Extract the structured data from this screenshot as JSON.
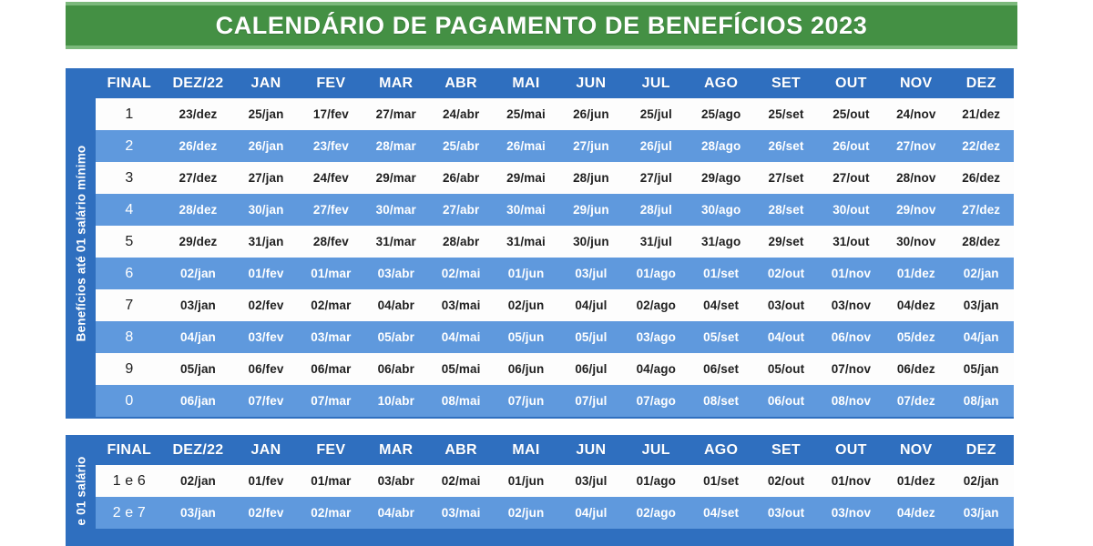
{
  "banner": {
    "title": "CALENDÁRIO DE PAGAMENTO DE BENEFÍCIOS 2023",
    "bg_color": "#449044",
    "edge_color": "#7cb97c",
    "text_color": "#ffffff"
  },
  "theme": {
    "header_blue": "#2f6fbf",
    "row_blue": "#5f99dd",
    "row_white": "#fdfdfd",
    "header_text": "#ffffff",
    "body_text_dark": "#1f1f1f",
    "body_text_light": "#ffffff"
  },
  "columns": [
    "FINAL",
    "DEZ/22",
    "JAN",
    "FEV",
    "MAR",
    "ABR",
    "MAI",
    "JUN",
    "JUL",
    "AGO",
    "SET",
    "OUT",
    "NOV",
    "DEZ"
  ],
  "table1": {
    "side_label": "Benefícios até 01 salário mínimo",
    "headers": [
      "FINAL",
      "DEZ/22",
      "JAN",
      "FEV",
      "MAR",
      "ABR",
      "MAI",
      "JUN",
      "JUL",
      "AGO",
      "SET",
      "OUT",
      "NOV",
      "DEZ"
    ],
    "rows": [
      {
        "final": "1",
        "shade": "light",
        "cells": [
          "23/dez",
          "25/jan",
          "17/fev",
          "27/mar",
          "24/abr",
          "25/mai",
          "26/jun",
          "25/jul",
          "25/ago",
          "25/set",
          "25/out",
          "24/nov",
          "21/dez"
        ]
      },
      {
        "final": "2",
        "shade": "dark",
        "cells": [
          "26/dez",
          "26/jan",
          "23/fev",
          "28/mar",
          "25/abr",
          "26/mai",
          "27/jun",
          "26/jul",
          "28/ago",
          "26/set",
          "26/out",
          "27/nov",
          "22/dez"
        ]
      },
      {
        "final": "3",
        "shade": "light",
        "cells": [
          "27/dez",
          "27/jan",
          "24/fev",
          "29/mar",
          "26/abr",
          "29/mai",
          "28/jun",
          "27/jul",
          "29/ago",
          "27/set",
          "27/out",
          "28/nov",
          "26/dez"
        ]
      },
      {
        "final": "4",
        "shade": "dark",
        "cells": [
          "28/dez",
          "30/jan",
          "27/fev",
          "30/mar",
          "27/abr",
          "30/mai",
          "29/jun",
          "28/jul",
          "30/ago",
          "28/set",
          "30/out",
          "29/nov",
          "27/dez"
        ]
      },
      {
        "final": "5",
        "shade": "light",
        "cells": [
          "29/dez",
          "31/jan",
          "28/fev",
          "31/mar",
          "28/abr",
          "31/mai",
          "30/jun",
          "31/jul",
          "31/ago",
          "29/set",
          "31/out",
          "30/nov",
          "28/dez"
        ]
      },
      {
        "final": "6",
        "shade": "dark",
        "cells": [
          "02/jan",
          "01/fev",
          "01/mar",
          "03/abr",
          "02/mai",
          "01/jun",
          "03/jul",
          "01/ago",
          "01/set",
          "02/out",
          "01/nov",
          "01/dez",
          "02/jan"
        ]
      },
      {
        "final": "7",
        "shade": "light",
        "cells": [
          "03/jan",
          "02/fev",
          "02/mar",
          "04/abr",
          "03/mai",
          "02/jun",
          "04/jul",
          "02/ago",
          "04/set",
          "03/out",
          "03/nov",
          "04/dez",
          "03/jan"
        ]
      },
      {
        "final": "8",
        "shade": "dark",
        "cells": [
          "04/jan",
          "03/fev",
          "03/mar",
          "05/abr",
          "04/mai",
          "05/jun",
          "05/jul",
          "03/ago",
          "05/set",
          "04/out",
          "06/nov",
          "05/dez",
          "04/jan"
        ]
      },
      {
        "final": "9",
        "shade": "light",
        "cells": [
          "05/jan",
          "06/fev",
          "06/mar",
          "06/abr",
          "05/mai",
          "06/jun",
          "06/jul",
          "04/ago",
          "06/set",
          "05/out",
          "07/nov",
          "06/dez",
          "05/jan"
        ]
      },
      {
        "final": "0",
        "shade": "dark",
        "cells": [
          "06/jan",
          "07/fev",
          "07/mar",
          "10/abr",
          "08/mai",
          "07/jun",
          "07/jul",
          "07/ago",
          "08/set",
          "06/out",
          "08/nov",
          "07/dez",
          "08/jan"
        ]
      }
    ]
  },
  "table2": {
    "side_label": "e 01 salário",
    "headers": [
      "FINAL",
      "DEZ/22",
      "JAN",
      "FEV",
      "MAR",
      "ABR",
      "MAI",
      "JUN",
      "JUL",
      "AGO",
      "SET",
      "OUT",
      "NOV",
      "DEZ"
    ],
    "rows": [
      {
        "final": "1 e 6",
        "shade": "light",
        "cells": [
          "02/jan",
          "01/fev",
          "01/mar",
          "03/abr",
          "02/mai",
          "01/jun",
          "03/jul",
          "01/ago",
          "01/set",
          "02/out",
          "01/nov",
          "01/dez",
          "02/jan"
        ]
      },
      {
        "final": "2 e 7",
        "shade": "dark",
        "cells": [
          "03/jan",
          "02/fev",
          "02/mar",
          "04/abr",
          "03/mai",
          "02/jun",
          "04/jul",
          "02/ago",
          "04/set",
          "03/out",
          "03/nov",
          "04/dez",
          "03/jan"
        ]
      }
    ]
  }
}
